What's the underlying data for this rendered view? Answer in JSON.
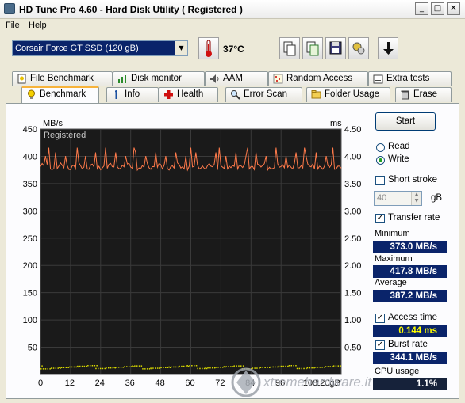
{
  "window": {
    "title": "HD Tune Pro 4.60 - Hard Disk Utility ( Registered )"
  },
  "menu": [
    "File",
    "Help"
  ],
  "toolbar": {
    "device": "Corsair Force GT SSD     (120 gB)",
    "temperature": "37°C"
  },
  "tabs_row1": [
    "File Benchmark",
    "Disk monitor",
    "AAM",
    "Random Access",
    "Extra tests"
  ],
  "tabs_row2": [
    "Benchmark",
    "Info",
    "Health",
    "Error Scan",
    "Folder Usage",
    "Erase"
  ],
  "chart": {
    "left_unit": "MB/s",
    "right_unit": "ms",
    "status": "Registered",
    "y_ticks_left": [
      "450",
      "400",
      "350",
      "300",
      "250",
      "200",
      "150",
      "100",
      "50"
    ],
    "y_ticks_right": [
      "4.50",
      "4.00",
      "3.50",
      "3.00",
      "2.50",
      "2.00",
      "1.50",
      "1.00",
      "0.50"
    ],
    "x_ticks": [
      "0",
      "12",
      "24",
      "36",
      "48",
      "60",
      "72",
      "84",
      "96",
      "108",
      "120gB"
    ]
  },
  "chart_data": {
    "type": "line",
    "title": "",
    "xlabel": "",
    "ylabel": "MB/s",
    "xlim": [
      0,
      120
    ],
    "ylim": [
      0,
      450
    ],
    "y2label": "ms",
    "y2lim": [
      0,
      4.5
    ],
    "series": [
      {
        "name": "Transfer rate",
        "color": "#ff7a4a",
        "min": 373.0,
        "max": 417.8,
        "avg": 387.2
      },
      {
        "name": "Access time",
        "color": "#d8d800",
        "avg_ms": 0.144
      }
    ],
    "grid": true
  },
  "side": {
    "start": "Start",
    "read": "Read",
    "write": "Write",
    "short_stroke": "Short stroke",
    "stroke_value": "40",
    "stroke_unit": "gB",
    "transfer_rate": "Transfer rate",
    "minimum_label": "Minimum",
    "minimum": "373.0 MB/s",
    "maximum_label": "Maximum",
    "maximum": "417.8 MB/s",
    "average_label": "Average",
    "average": "387.2 MB/s",
    "access_time": "Access time",
    "access_value": "0.144 ms",
    "burst_rate": "Burst rate",
    "burst_value": "344.1 MB/s",
    "cpu_label": "CPU usage",
    "cpu_value": "1.1%"
  },
  "watermark": "xtremehardware.it"
}
